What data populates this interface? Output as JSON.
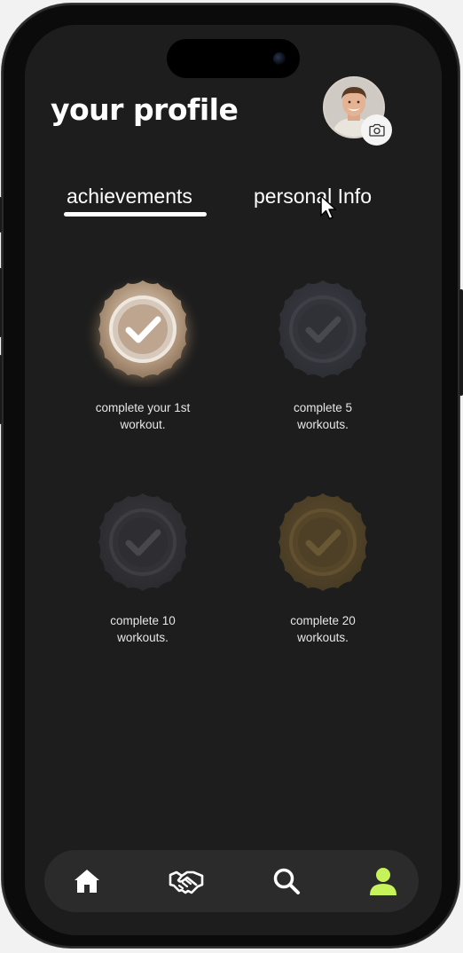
{
  "header": {
    "title": "your profile",
    "avatar_icon": "user-photo",
    "camera_icon": "camera-icon"
  },
  "tabs": [
    {
      "label": "achievements",
      "active": true
    },
    {
      "label": "personal Info",
      "active": false
    }
  ],
  "achievements": [
    {
      "label_line1": "complete your 1st",
      "label_line2": "workout.",
      "unlocked": true,
      "color": "#b9a48e"
    },
    {
      "label_line1": "complete 5",
      "label_line2": "workouts.",
      "unlocked": false,
      "color": "#3a3a42"
    },
    {
      "label_line1": "complete 10",
      "label_line2": "workouts.",
      "unlocked": false,
      "color": "#36363b"
    },
    {
      "label_line1": "complete 20",
      "label_line2": "workouts.",
      "unlocked": false,
      "color": "#5b4a2c"
    }
  ],
  "bottom_nav": [
    {
      "icon": "home-icon",
      "active": false
    },
    {
      "icon": "handshake-icon",
      "active": false
    },
    {
      "icon": "search-icon",
      "active": false
    },
    {
      "icon": "profile-icon",
      "active": true
    }
  ],
  "colors": {
    "background": "#1d1d1d",
    "nav_bar": "#2b2b2b",
    "accent_active": "#c6f25a",
    "text": "#ffffff"
  }
}
